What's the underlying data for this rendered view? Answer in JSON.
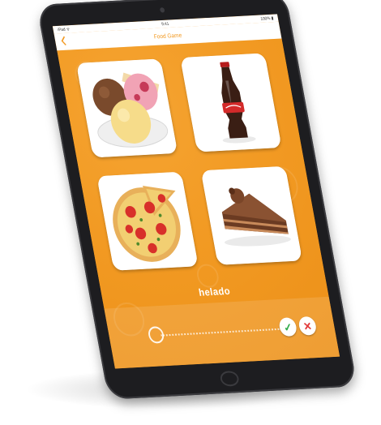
{
  "status_bar": {
    "carrier": "iPad ᯤ",
    "time": "9:41",
    "battery": "100% ▮"
  },
  "nav": {
    "title": "Food Game",
    "back_icon": "chevron-left-icon"
  },
  "cards": [
    {
      "item": "ice-cream",
      "icon": "ice-cream-image"
    },
    {
      "item": "cola-bottle",
      "icon": "cola-bottle-image"
    },
    {
      "item": "pizza",
      "icon": "pizza-image"
    },
    {
      "item": "chocolate-cake",
      "icon": "cake-image"
    }
  ],
  "answer": {
    "word": "helado"
  },
  "controls": {
    "check_symbol": "✓",
    "close_symbol": "✕",
    "mic_icon": "microphone-icon"
  },
  "colors": {
    "accent": "#f29a23",
    "check": "#2eaa4a",
    "close": "#e23b3b",
    "device": "#1d1d20"
  }
}
